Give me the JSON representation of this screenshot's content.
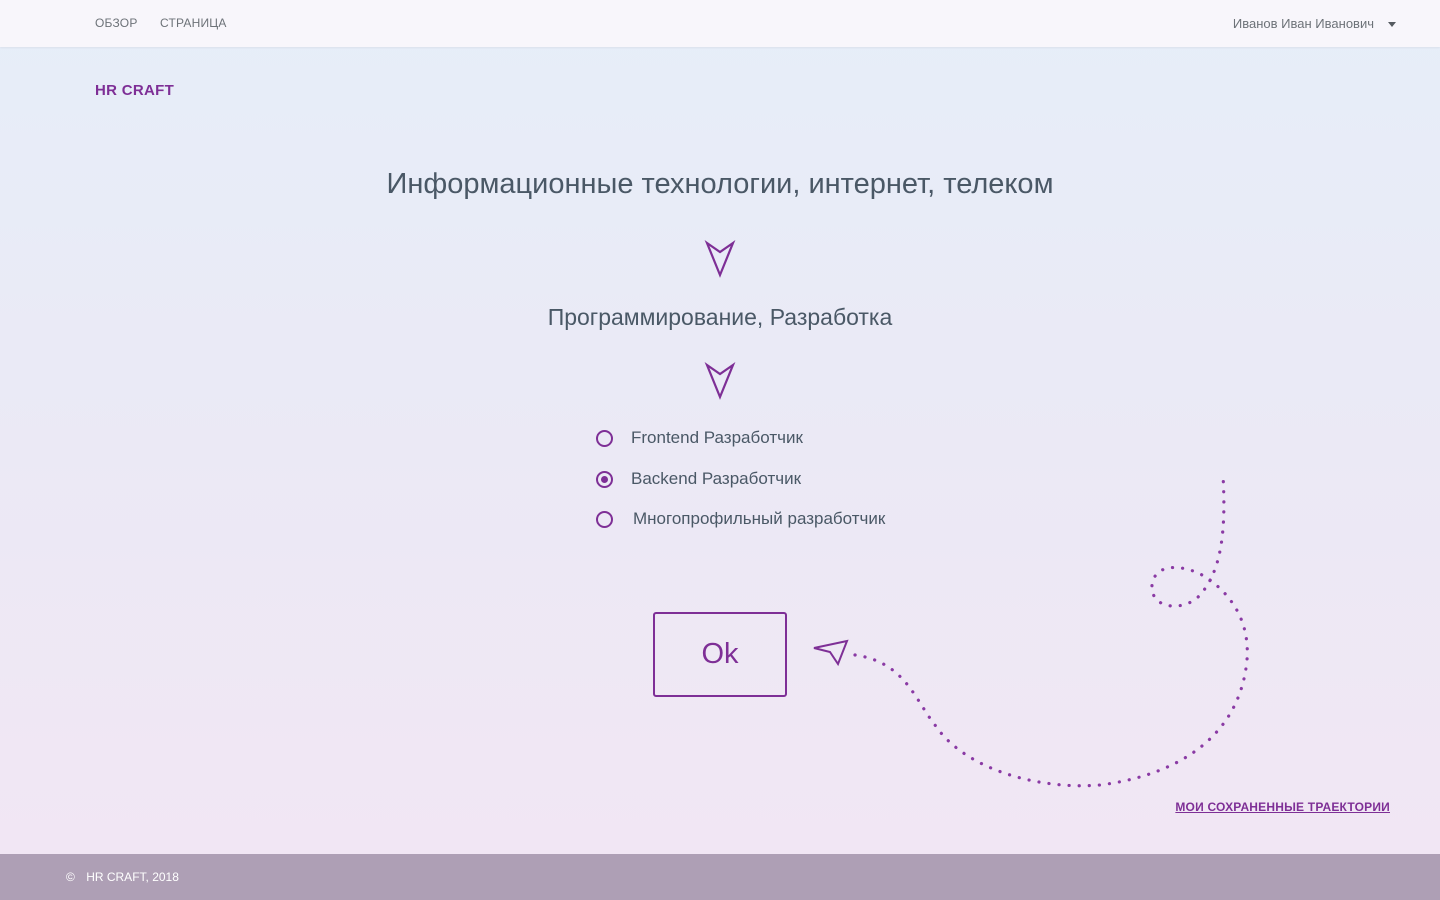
{
  "nav": {
    "links": [
      "ОБЗОР",
      "СТРАНИЦА"
    ],
    "user_name": "Иванов Иван Иванович",
    "user_menu_icon": "caret-down-icon"
  },
  "brand": {
    "logo": "HR CRAFT"
  },
  "trajectory": {
    "industry": "Информационные технологии, интернет, телеком",
    "specialization": "Программирование, Разработка",
    "arrow_icon": "arrow-down-icon",
    "options": [
      {
        "label": "Frontend Разработчик",
        "selected": false
      },
      {
        "label": "Backend Разработчик",
        "selected": true
      },
      {
        "label": "Многопрофильный разработчик",
        "selected": false
      }
    ]
  },
  "actions": {
    "ok_label": "Ok",
    "saved_link": "МОИ СОХРАНЕННЫЕ ТРАЕКТОРИИ"
  },
  "footer": {
    "copyright_symbol": "©",
    "text": "HR CRAFT, 2018"
  },
  "colors": {
    "accent": "#7e2f96",
    "text": "#4a5866",
    "nav_text": "#6d7278",
    "footer_bg": "#ae9fb5",
    "topbar_bg": "#f8f6fb"
  }
}
